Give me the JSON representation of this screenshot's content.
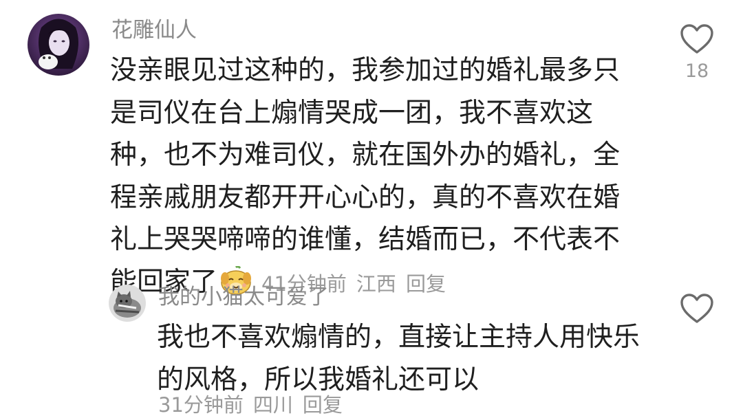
{
  "comment": {
    "username": "花雕仙人",
    "lines": [
      "没亲眼见过这种的，我参加过的婚礼最多只",
      "是司仪在台上煽情哭成一团，我不喜欢这",
      "种，也不为难司仪，就在国外办的婚礼，全",
      "程亲戚朋友都开开心心的，真的不喜欢在婚",
      "礼上哭哭啼啼的谁懂，结婚而已，不代表不",
      "能回家了"
    ],
    "emoji": "smiling-dog-emoji",
    "time": "41分钟前",
    "location": "江西",
    "reply_label": "回复",
    "like_count": "18",
    "like_icon": "heart-outline-icon"
  },
  "reply": {
    "username": "我的小猫太可爱了",
    "lines": [
      "我也不喜欢煽情的，直接让主持人用快乐",
      "的风格，所以我婚礼还可以"
    ],
    "time": "31分钟前",
    "location": "四川",
    "reply_label": "回复",
    "like_icon": "heart-outline-icon"
  },
  "colors": {
    "text": "#1f1f1f",
    "secondary": "#8a8a8a",
    "meta": "#9a9a9a"
  }
}
